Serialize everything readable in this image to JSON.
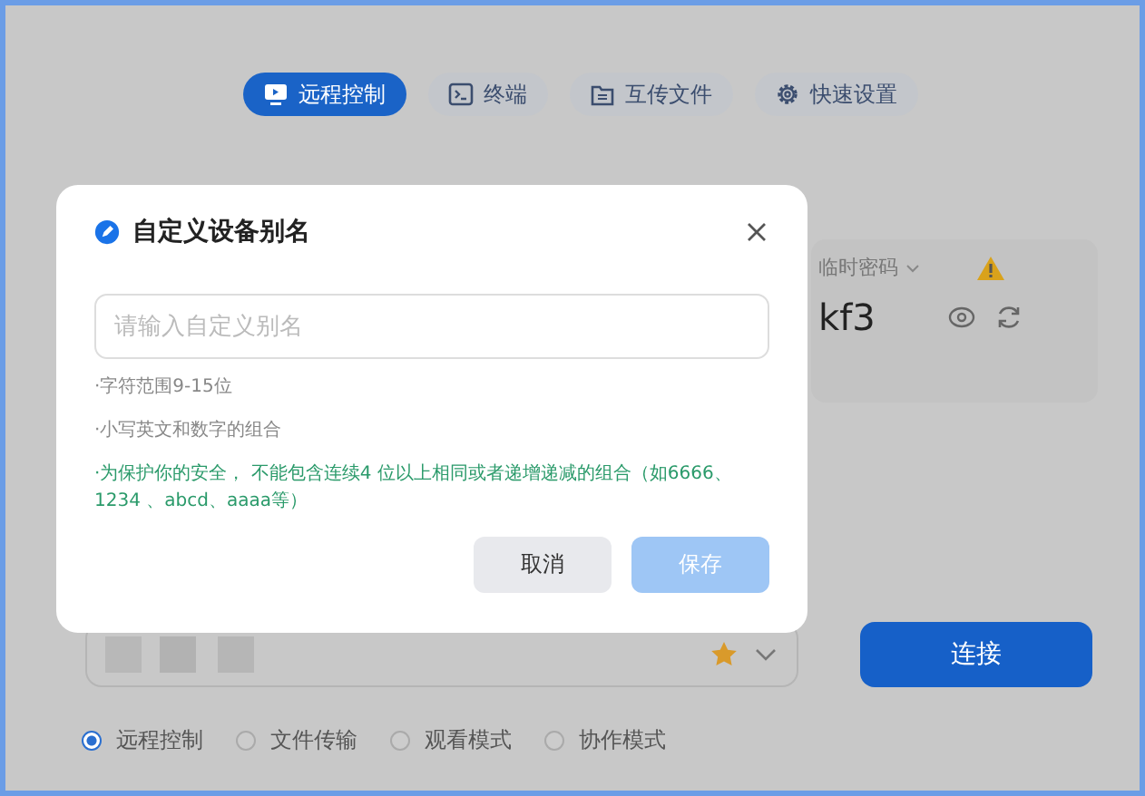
{
  "tabs": [
    {
      "label": "远程控制",
      "kind": "monitor",
      "selected": true
    },
    {
      "label": "终端",
      "kind": "terminal",
      "selected": false
    },
    {
      "label": "互传文件",
      "kind": "folder",
      "selected": false
    },
    {
      "label": "快速设置",
      "kind": "gear",
      "selected": false
    }
  ],
  "password_card": {
    "label": "临时密码",
    "value": "kf3",
    "warning": true
  },
  "dialog": {
    "title": "自定义设备别名",
    "input": {
      "placeholder": "请输入自定义别名"
    },
    "hints": [
      {
        "text": "·字符范围9-15位",
        "kind": "note"
      },
      {
        "text": "·小写英文和数字的组合",
        "kind": "note"
      },
      {
        "text": "·为保护你的安全， 不能包含连续4 位以上相同或者递增递减的组合（如6666、1234 、abcd、aaaa等）",
        "kind": "warning"
      }
    ],
    "buttons": [
      {
        "label": "取消",
        "kind": "secondary",
        "disabled": false
      },
      {
        "label": "保存",
        "kind": "primary",
        "disabled": true
      }
    ]
  },
  "connect": {
    "favorite": true,
    "button": "连接"
  },
  "modes": [
    {
      "label": "远程控制",
      "selected": true
    },
    {
      "label": "文件传输",
      "selected": false
    },
    {
      "label": "观看模式",
      "selected": false
    },
    {
      "label": "协作模式",
      "selected": false
    }
  ]
}
